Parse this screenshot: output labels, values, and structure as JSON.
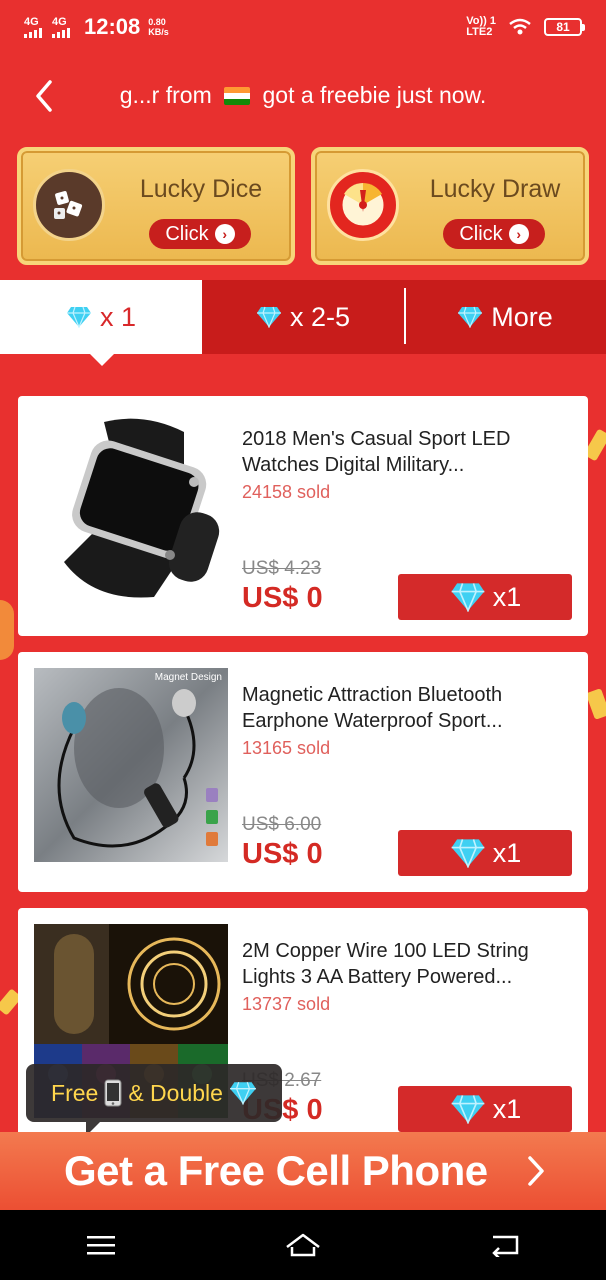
{
  "status_bar": {
    "net1": "4G",
    "net2": "4G",
    "time": "12:08",
    "speed_value": "0.80",
    "speed_unit": "KB/s",
    "volte_top": "Vo)) 1",
    "volte_bottom": "LTE2",
    "battery": "81"
  },
  "header": {
    "ticker_before": "g...r from",
    "ticker_after": "got a freebie just now."
  },
  "games": [
    {
      "title": "Lucky Dice",
      "button": "Click"
    },
    {
      "title": "Lucky Draw",
      "button": "Click"
    }
  ],
  "tabs": [
    {
      "label": "x 1"
    },
    {
      "label": "x 2-5"
    },
    {
      "label": "More"
    }
  ],
  "products": [
    {
      "name": "2018 Men's Casual Sport LED Watches Digital Military...",
      "sold": "24158 sold",
      "old_price": "US$ 4.23",
      "price": "US$ 0",
      "redeem": "x1"
    },
    {
      "name": "Magnetic Attraction Bluetooth Earphone Waterproof Sport...",
      "sold": "13165 sold",
      "old_price": "US$ 6.00",
      "price": "US$ 0",
      "redeem": "x1",
      "image_caption": "Magnet Design"
    },
    {
      "name": "2M Copper Wire 100 LED String Lights 3 AA Battery Powered...",
      "sold": "13737 sold",
      "old_price": "US$ 2.67",
      "price": "US$ 0",
      "redeem": "x1"
    }
  ],
  "tooltip": {
    "free": "Free",
    "double": "& Double"
  },
  "banner": {
    "text": "Get a Free Cell Phone"
  },
  "colors": {
    "background": "#e8302f",
    "tab_bar": "#c81c1b",
    "accent_red": "#d42a24",
    "gold": "#f6cf74",
    "diamond": "#3fd0f2"
  },
  "icons": [
    "back-chevron-icon",
    "india-flag-icon",
    "dice-icon",
    "wheel-icon",
    "diamond-icon",
    "phone-icon",
    "menu-icon",
    "home-icon",
    "back-nav-icon"
  ]
}
